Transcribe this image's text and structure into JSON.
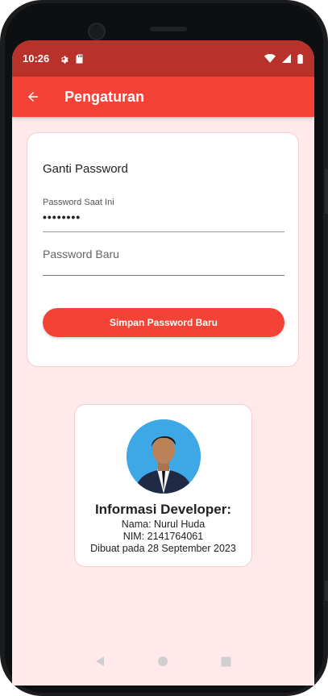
{
  "statusbar": {
    "time": "10:26",
    "icons": [
      "gear-icon",
      "sd-card-icon",
      "wifi-icon",
      "signal-icon",
      "battery-icon"
    ]
  },
  "appbar": {
    "title": "Pengaturan",
    "back_icon": "arrow-left-icon",
    "color": "#f44336"
  },
  "password_card": {
    "heading": "Ganti Password",
    "current_label": "Password Saat Ini",
    "current_value": "••••••••",
    "new_placeholder": "Password Baru",
    "save_label": "Simpan Password Baru"
  },
  "developer": {
    "title": "Informasi Developer:",
    "name": "Nama: Nurul Huda",
    "nim": "NIM: 2141764061",
    "created": "Dibuat pada 28 September 2023"
  },
  "navbar": {
    "icons": [
      "back-triangle-icon",
      "home-circle-icon",
      "recents-square-icon"
    ]
  },
  "colors": {
    "primary": "#f44336",
    "status_bar": "#b8312a",
    "background": "#ffe9ea"
  }
}
